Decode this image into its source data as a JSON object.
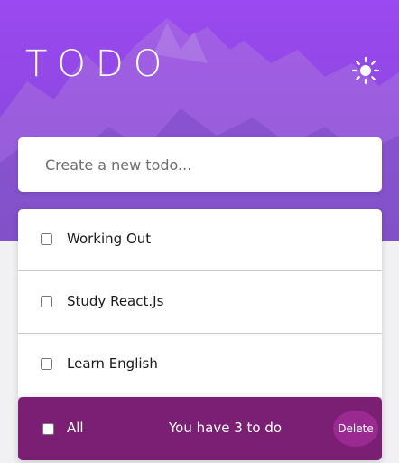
{
  "header": {
    "title": "TODO",
    "theme_icon": "sun-icon"
  },
  "new_todo": {
    "placeholder": "Create a new todo...",
    "value": ""
  },
  "todos": [
    {
      "label": "Working Out",
      "checked": false
    },
    {
      "label": "Study React.Js",
      "checked": false
    },
    {
      "label": "Learn English",
      "checked": false
    }
  ],
  "footer": {
    "all_label": "All",
    "count_text": "You have 3 to do",
    "delete_label": "Delete"
  },
  "colors": {
    "hero_gradient_top": "#9b49f0",
    "hero_gradient_bottom": "#7b46d0",
    "footer_bg": "#7a1f73",
    "delete_button_bg": "#9a2a92"
  }
}
